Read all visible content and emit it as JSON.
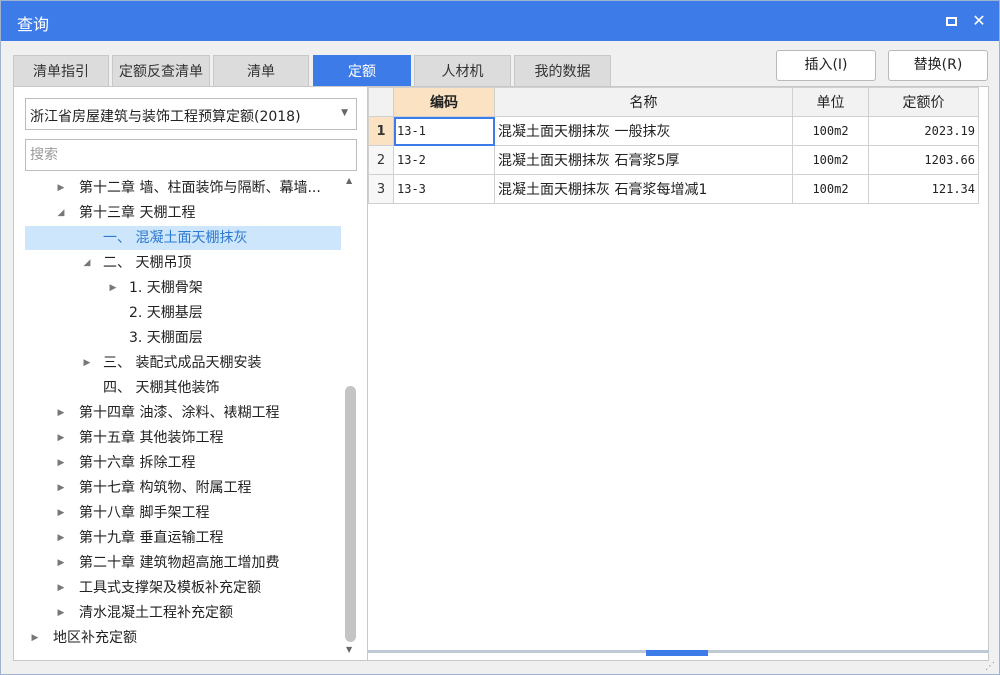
{
  "window": {
    "title": "查询",
    "accent": "#3d7ce8"
  },
  "tabs": [
    {
      "label": "清单指引",
      "active": false
    },
    {
      "label": "定额反查清单",
      "active": false
    },
    {
      "label": "清单",
      "active": false
    },
    {
      "label": "定额",
      "active": true
    },
    {
      "label": "人材机",
      "active": false
    },
    {
      "label": "我的数据",
      "active": false
    }
  ],
  "actions": {
    "insert": "插入(I)",
    "replace": "替换(R)"
  },
  "left": {
    "library": "浙江省房屋建筑与装饰工程预算定额(2018)",
    "search_placeholder": "搜索",
    "tree": [
      {
        "label": "第十二章 墙、柱面装饰与隔断、幕墙...",
        "state": "collapsed"
      },
      {
        "label": "第十三章 天棚工程",
        "state": "expanded"
      },
      {
        "label": "一、 混凝土面天棚抹灰",
        "state": "leaf",
        "selected": true
      },
      {
        "label": "二、 天棚吊顶",
        "state": "expanded"
      },
      {
        "label": "1. 天棚骨架",
        "state": "collapsed"
      },
      {
        "label": "2. 天棚基层",
        "state": "leaf"
      },
      {
        "label": "3. 天棚面层",
        "state": "leaf"
      },
      {
        "label": "三、 装配式成品天棚安装",
        "state": "collapsed"
      },
      {
        "label": "四、 天棚其他装饰",
        "state": "leaf"
      },
      {
        "label": "第十四章 油漆、涂料、裱糊工程",
        "state": "collapsed"
      },
      {
        "label": "第十五章 其他装饰工程",
        "state": "collapsed"
      },
      {
        "label": "第十六章 拆除工程",
        "state": "collapsed"
      },
      {
        "label": "第十七章 构筑物、附属工程",
        "state": "collapsed"
      },
      {
        "label": "第十八章 脚手架工程",
        "state": "collapsed"
      },
      {
        "label": "第十九章 垂直运输工程",
        "state": "collapsed"
      },
      {
        "label": "第二十章 建筑物超高施工增加费",
        "state": "collapsed"
      },
      {
        "label": "工具式支撑架及模板补充定额",
        "state": "collapsed"
      },
      {
        "label": "清水混凝土工程补充定额",
        "state": "collapsed"
      },
      {
        "label": "地区补充定额",
        "state": "collapsed"
      }
    ]
  },
  "grid": {
    "columns": [
      "编码",
      "名称",
      "单位",
      "定额价"
    ],
    "rows": [
      {
        "n": "1",
        "code": "13-1",
        "name": "混凝土面天棚抹灰 一般抹灰",
        "unit": "100m2",
        "price": "2023.19"
      },
      {
        "n": "2",
        "code": "13-2",
        "name": "混凝土面天棚抹灰 石膏浆5厚",
        "unit": "100m2",
        "price": "1203.66"
      },
      {
        "n": "3",
        "code": "13-3",
        "name": "混凝土面天棚抹灰 石膏浆每增减1",
        "unit": "100m2",
        "price": "121.34"
      }
    ]
  }
}
